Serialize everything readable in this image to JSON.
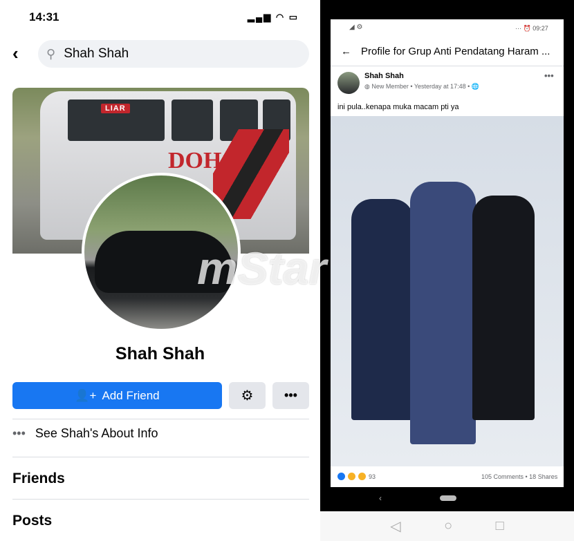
{
  "left": {
    "status": {
      "time": "14:31",
      "icons": "signal-wifi-battery"
    },
    "search": {
      "back_icon": "chevron-left-icon",
      "icon": "search-icon",
      "value": "Shah Shah"
    },
    "cover": {
      "van_text": "DOHC",
      "sign": "LIAR"
    },
    "profile": {
      "name": "Shah Shah"
    },
    "actions": {
      "add_friend": "Add Friend",
      "gear_icon": "gear-icon",
      "more_icon": "more-icon"
    },
    "about": {
      "icon": "•••",
      "label": "See Shah's About Info"
    },
    "sections": {
      "friends": "Friends",
      "posts": "Posts"
    }
  },
  "right": {
    "status": {
      "left": "◢ ⚙",
      "right": "··· ⏰ 09:27"
    },
    "header": {
      "back": "←",
      "title": "Profile for Grup Anti Pendatang Haram ..."
    },
    "post": {
      "author": "Shah Shah",
      "meta": "◍ New Member • Yesterday at 17:48 • 🌐",
      "more": "•••",
      "text": "ini pula..kenapa muka macam pti ya",
      "reactions": "93",
      "counts": "105 Comments • 18 Shares"
    },
    "nav": {
      "back": "‹",
      "sys_back": "◁",
      "sys_home": "○",
      "sys_recent": "□"
    }
  },
  "watermark": "mStar",
  "colors": {
    "accent": "#1877f2",
    "button_gray": "#e4e6eb"
  }
}
